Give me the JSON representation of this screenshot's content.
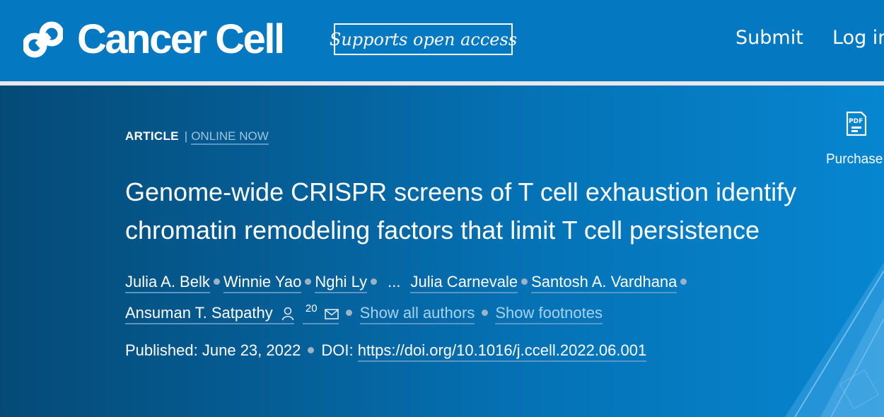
{
  "header": {
    "journal_name": "Cancer Cell",
    "badge": "Supports open access",
    "nav": {
      "submit": "Submit",
      "login": "Log in"
    }
  },
  "article": {
    "type": "ARTICLE",
    "separator": "|",
    "status": "ONLINE NOW",
    "title": "Genome-wide CRISPR screens of T cell exhaustion identify chromatin remodeling factors that limit T cell persistence",
    "authors": [
      "Julia A. Belk",
      "Winnie Yao",
      "Nghi Ly",
      "Julia Carnevale",
      "Santosh A. Vardhana",
      "Ansuman T. Satpathy"
    ],
    "ellipsis": "...",
    "corresponding_count": "20",
    "show_all_authors": "Show all authors",
    "show_footnotes": "Show footnotes",
    "published_label": "Published:",
    "published_date": "June 23, 2022",
    "doi_label": "DOI:",
    "doi": "https://doi.org/10.1016/j.ccell.2022.06.001"
  },
  "sidebar": {
    "pdf_icon_label": "PDF",
    "purchase_label": "Purchase"
  },
  "icons": {
    "logo": "cancer-cell-logo-icon",
    "person": "person-icon",
    "mail": "mail-icon",
    "pdf": "pdf-icon"
  },
  "colors": {
    "header_blue": "#0478c1",
    "hero_dark": "#054a77",
    "hero_light": "#0686d0",
    "link_light": "#a9d2ef"
  }
}
